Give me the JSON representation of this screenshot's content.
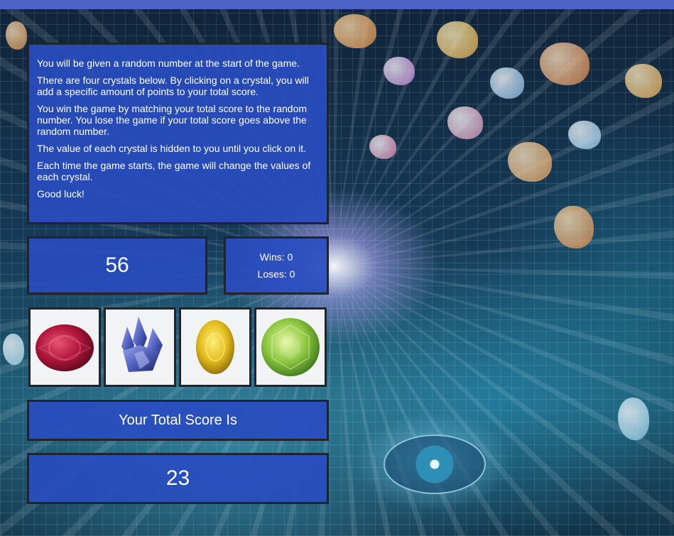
{
  "instructions": {
    "paragraphs": [
      "You will be given a random number at the start of the game.",
      "There are four crystals below. By clicking on a crystal, you will add a specific amount of points to your total score.",
      "You win the game by matching your total score to the random number. You lose the game if your total score goes above the random number.",
      "The value of each crystal is hidden to you until you click on it.",
      "Each time the game starts, the game will change the values of each crystal.",
      "Good luck!"
    ]
  },
  "target_number": "56",
  "record": {
    "wins": "Wins: 0",
    "loses": "Loses: 0"
  },
  "crystals": [
    {
      "icon": "ruby-crystal-icon",
      "color": "#b0153a"
    },
    {
      "icon": "blue-cluster-crystal-icon",
      "color": "#4a5ab8"
    },
    {
      "icon": "yellow-oval-crystal-icon",
      "color": "#e3bd1c"
    },
    {
      "icon": "green-round-crystal-icon",
      "color": "#8cc640"
    }
  ],
  "score_label": "Your Total Score Is",
  "total_score": "23",
  "colors": {
    "top_bar": "#4c62c6",
    "panel_fill": "#284cbe",
    "panel_border": "#20242c",
    "text": "#ffffff"
  }
}
